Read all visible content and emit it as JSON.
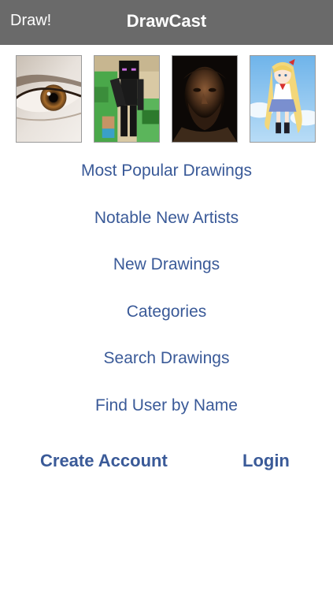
{
  "navbar": {
    "left_label": "Draw!",
    "title": "DrawCast",
    "background": "#6a6a6a"
  },
  "thumbnails": [
    {
      "name": "eye-drawing"
    },
    {
      "name": "minecraft-enderman-drawing"
    },
    {
      "name": "bearded-man-portrait-drawing"
    },
    {
      "name": "anime-girl-drawing"
    }
  ],
  "menu": {
    "items": [
      {
        "label": "Most Popular Drawings"
      },
      {
        "label": "Notable New Artists"
      },
      {
        "label": "New Drawings"
      },
      {
        "label": "Categories"
      },
      {
        "label": "Search Drawings"
      },
      {
        "label": "Find User by Name"
      }
    ],
    "color": "#3a5a98"
  },
  "actions": {
    "create_account": "Create Account",
    "login": "Login"
  }
}
